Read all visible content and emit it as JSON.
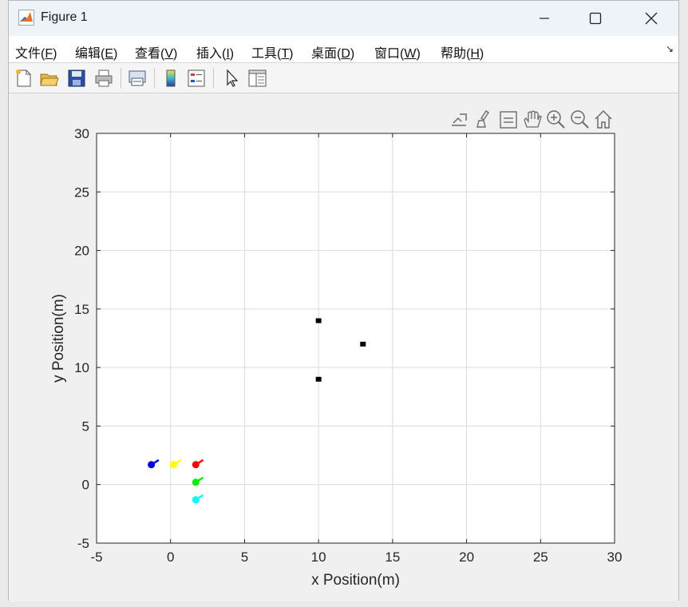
{
  "window": {
    "title": "Figure 1"
  },
  "menu": [
    {
      "label": "文件(",
      "key": "F"
    },
    {
      "label": "编辑(",
      "key": "E"
    },
    {
      "label": "查看(",
      "key": "V"
    },
    {
      "label": "插入(",
      "key": "I"
    },
    {
      "label": "工具(",
      "key": "T"
    },
    {
      "label": "桌面(",
      "key": "D"
    },
    {
      "label": "窗口(",
      "key": "W"
    },
    {
      "label": "帮助(",
      "key": "H"
    }
  ],
  "toolbar_icons": [
    "new-figure-icon",
    "open-file-icon",
    "save-icon",
    "print-icon",
    "print-preview-icon",
    "colorbar-icon",
    "legend-icon",
    "pointer-icon",
    "property-inspector-icon"
  ],
  "axes_toolbar_icons": [
    "export-icon",
    "brush-icon",
    "datatip-icon",
    "pan-icon",
    "zoom-in-icon",
    "zoom-out-icon",
    "home-icon"
  ],
  "chart_data": {
    "type": "scatter",
    "xlabel": "x Position(m)",
    "ylabel": "y Position(m)",
    "xlim": [
      -5,
      30
    ],
    "ylim": [
      -5,
      30
    ],
    "xticks": [
      -5,
      0,
      5,
      10,
      15,
      20,
      25,
      30
    ],
    "yticks": [
      -5,
      0,
      5,
      10,
      15,
      20,
      25,
      30
    ],
    "grid": true,
    "markers_square": {
      "color": "#000000",
      "points": [
        [
          10,
          14
        ],
        [
          13,
          12
        ],
        [
          10,
          9
        ]
      ]
    },
    "agents": [
      {
        "color": "#0000e0",
        "x": -1.3,
        "y": 1.7,
        "hx": -0.8,
        "hy": 2.1
      },
      {
        "color": "#ffff00",
        "x": 0.2,
        "y": 1.7,
        "hx": 0.7,
        "hy": 2.1
      },
      {
        "color": "#ff0000",
        "x": 1.7,
        "y": 1.7,
        "hx": 2.2,
        "hy": 2.1
      },
      {
        "color": "#00ee00",
        "x": 1.7,
        "y": 0.2,
        "hx": 2.2,
        "hy": 0.6
      },
      {
        "color": "#00ffff",
        "x": 1.7,
        "y": -1.3,
        "hx": 2.2,
        "hy": -0.9
      }
    ]
  }
}
